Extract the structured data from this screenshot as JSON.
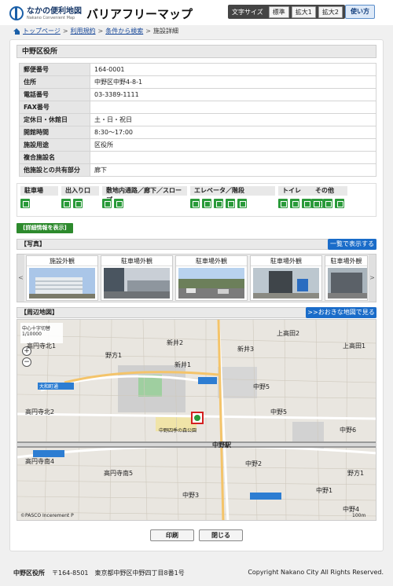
{
  "header": {
    "logo_ja": "なかの便利地図",
    "logo_en": "Nakano Convenient Map",
    "title": "バリアフリーマップ",
    "text_size_label": "文字サイズ",
    "size_buttons": [
      "標準",
      "拡大1",
      "拡大2"
    ],
    "help_label": "使い方"
  },
  "breadcrumb": {
    "items": [
      "トップページ",
      "利用規約",
      "条件から検索"
    ],
    "current": "施設詳細",
    "separator": ">"
  },
  "facility": {
    "name": "中野区役所",
    "rows": [
      {
        "key": "郵便番号",
        "value": "164-0001"
      },
      {
        "key": "住所",
        "value": "中野区中野4-8-1"
      },
      {
        "key": "電話番号",
        "value": "03-3389-1111"
      },
      {
        "key": "FAX番号",
        "value": ""
      },
      {
        "key": "定休日・休館日",
        "value": "土・日・祝日"
      },
      {
        "key": "開館時間",
        "value": "8:30～17:00"
      },
      {
        "key": "施設用途",
        "value": "区役所"
      },
      {
        "key": "複合施設名",
        "value": ""
      },
      {
        "key": "他施設との共有部分",
        "value": "廊下"
      }
    ]
  },
  "facilities": {
    "categories": [
      {
        "label": "駐車場",
        "icon_count": 1
      },
      {
        "label": "出入り口",
        "icon_count": 2
      },
      {
        "label": "敷地内通路／廊下／スロープ",
        "icon_count": 2
      },
      {
        "label": "エレベータ／階段",
        "icon_count": 5
      },
      {
        "label": "トイレ",
        "icon_count": 4
      },
      {
        "label": "その他",
        "icon_count": 3
      }
    ]
  },
  "detail_button": "[詳細情報を表示]",
  "photos": {
    "heading": "【写真】",
    "list_button": "一覧で表示する",
    "prev": "<",
    "next": ">",
    "items": [
      "施設外観",
      "駐車場外観",
      "駐車場外観",
      "駐車場外観",
      "駐車場外観"
    ]
  },
  "map": {
    "heading": "【周辺地図】",
    "large_button": ">>おおきな地図で見る",
    "crosshair_toggle": "中心十字切替",
    "scale": "1/10000",
    "zoom_in": "+",
    "zoom_out": "−",
    "copyright": "©PASCO  Incerement P",
    "scalebar": "100m",
    "labels": [
      "野方1",
      "新井2",
      "新井3",
      "上高田2",
      "新井1",
      "中野5",
      "高円寺北2",
      "高円寺南4",
      "高円寺南5",
      "中野3",
      "中野2",
      "中野4",
      "中野6",
      "野方1",
      "中野駅",
      "中野四季の森公園",
      "大和町通",
      "上高田1",
      "高円寺北1",
      "中野1",
      "中野5"
    ]
  },
  "buttons": {
    "print": "印刷",
    "close": "閉じる"
  },
  "footer": {
    "name": "中野区役所",
    "address": "〒164-8501　東京都中野区中野四丁目8番1号",
    "copyright": "Copyright Nakano City All Rights Reserved."
  }
}
